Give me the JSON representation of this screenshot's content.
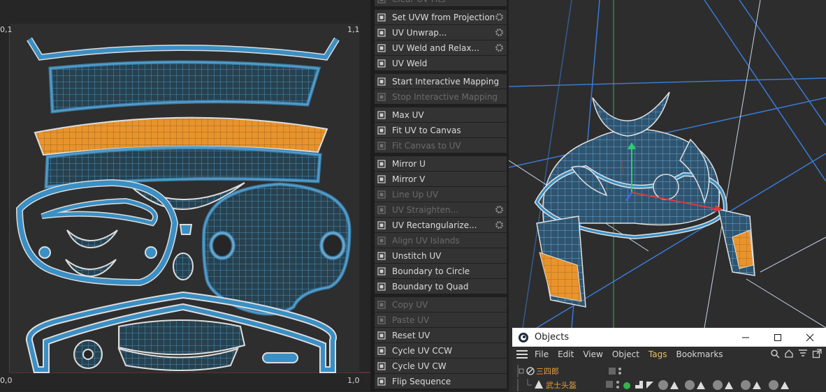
{
  "uv_editor": {
    "label_top_left": "0,1",
    "label_top_right": "1,1",
    "label_bottom_left": "0,0",
    "label_bottom_right": "1,0"
  },
  "uv_menu": {
    "items": [
      {
        "label": "Clear UV Fits",
        "icon": "clear-icon",
        "disabled": true,
        "gear": false
      },
      {
        "label": "Set UVW from Projection...",
        "icon": "projection-icon",
        "disabled": false,
        "gear": true
      },
      {
        "label": "UV Unwrap...",
        "icon": "unwrap-icon",
        "disabled": false,
        "gear": true
      },
      {
        "label": "UV Weld and Relax...",
        "icon": "weld-relax-icon",
        "disabled": false,
        "gear": true
      },
      {
        "label": "UV Weld",
        "icon": "weld-icon",
        "disabled": false,
        "gear": false
      },
      {
        "label": "Start Interactive Mapping",
        "icon": "play-icon",
        "disabled": false,
        "gear": false
      },
      {
        "label": "Stop Interactive Mapping",
        "icon": "stop-icon",
        "disabled": true,
        "gear": false
      },
      {
        "label": "Max UV",
        "icon": "max-uv-icon",
        "disabled": false,
        "gear": false
      },
      {
        "label": "Fit UV to Canvas",
        "icon": "fit-uv-icon",
        "disabled": false,
        "gear": false
      },
      {
        "label": "Fit Canvas to UV",
        "icon": "fit-canvas-icon",
        "disabled": true,
        "gear": false
      },
      {
        "label": "Mirror U",
        "icon": "mirror-u-icon",
        "disabled": false,
        "gear": false
      },
      {
        "label": "Mirror V",
        "icon": "mirror-v-icon",
        "disabled": false,
        "gear": false
      },
      {
        "label": "Line Up UV",
        "icon": "line-up-icon",
        "disabled": true,
        "gear": false
      },
      {
        "label": "UV Straighten...",
        "icon": "straighten-icon",
        "disabled": true,
        "gear": true
      },
      {
        "label": "UV Rectangularize...",
        "icon": "rectangularize-icon",
        "disabled": false,
        "gear": true
      },
      {
        "label": "Align UV Islands",
        "icon": "align-icon",
        "disabled": true,
        "gear": false
      },
      {
        "label": "Unstitch UV",
        "icon": "unstitch-icon",
        "disabled": false,
        "gear": false
      },
      {
        "label": "Boundary to Circle",
        "icon": "circle-icon",
        "disabled": false,
        "gear": false
      },
      {
        "label": "Boundary to Quad",
        "icon": "quad-icon",
        "disabled": false,
        "gear": false
      },
      {
        "label": "Copy UV",
        "icon": "copy-icon",
        "disabled": true,
        "gear": false
      },
      {
        "label": "Paste UV",
        "icon": "paste-icon",
        "disabled": true,
        "gear": false
      },
      {
        "label": "Reset UV",
        "icon": "reset-icon",
        "disabled": false,
        "gear": false
      },
      {
        "label": "Cycle UV CCW",
        "icon": "cycle-ccw-icon",
        "disabled": false,
        "gear": false
      },
      {
        "label": "Cycle UV CW",
        "icon": "cycle-cw-icon",
        "disabled": false,
        "gear": false
      },
      {
        "label": "Flip Sequence",
        "icon": "flip-icon",
        "disabled": false,
        "gear": false
      }
    ]
  },
  "objects_panel": {
    "title": "Objects",
    "menu": [
      "File",
      "Edit",
      "View",
      "Object",
      "Tags",
      "Bookmarks"
    ],
    "active_menu": "Tags",
    "rows": [
      {
        "name": "三四郎"
      },
      {
        "name": "武士头盔"
      }
    ]
  },
  "colors": {
    "uv_edge": "#3a8fc4",
    "uv_selected": "#e8932c",
    "menu_bg": "#333333",
    "tag_active": "#e8c25a"
  }
}
